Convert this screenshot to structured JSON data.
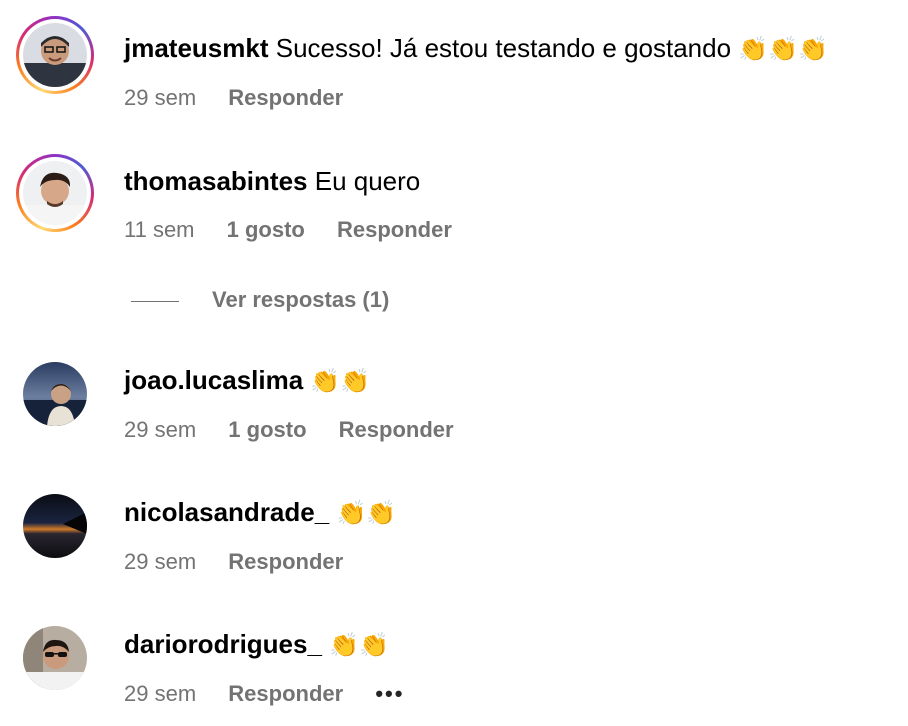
{
  "comments": [
    {
      "username": "jmateusmkt",
      "text": "Sucesso! Já estou testando e gostando",
      "emoji": "👏👏👏",
      "time": "29 sem",
      "likes": "",
      "reply": "Responder",
      "story_ring": true
    },
    {
      "username": "thomasabintes",
      "text": "Eu quero",
      "emoji": "",
      "time": "11 sem",
      "likes": "1 gosto",
      "reply": "Responder",
      "story_ring": true,
      "view_replies": "Ver respostas (1)"
    },
    {
      "username": "joao.lucaslima",
      "text": "",
      "emoji": "👏👏",
      "time": "29 sem",
      "likes": "1 gosto",
      "reply": "Responder",
      "story_ring": false
    },
    {
      "username": "nicolasandrade_",
      "text": "",
      "emoji": "👏👏",
      "time": "29 sem",
      "likes": "",
      "reply": "Responder",
      "story_ring": false
    },
    {
      "username": "dariorodrigues_",
      "text": "",
      "emoji": "👏👏",
      "time": "29 sem",
      "likes": "",
      "reply": "Responder",
      "story_ring": false,
      "more": "•••"
    }
  ],
  "colors": {
    "meta_text": "#737373",
    "ring_start": "#feda75",
    "ring_end": "#962fbf"
  }
}
